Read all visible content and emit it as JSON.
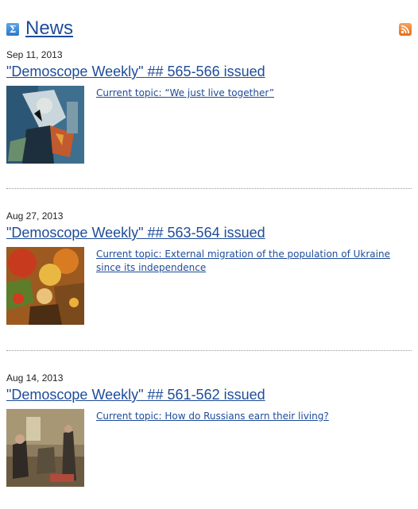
{
  "header": {
    "title": "News",
    "sigma_icon": "sigma-icon",
    "rss_icon": "rss-icon"
  },
  "items": [
    {
      "date": "Sep 11, 2013",
      "headline": "\"Demoscope Weekly\" ## 565-566 issued",
      "topic": "Current topic: “We just live together”",
      "thumbnail": "painting-thumbnail"
    },
    {
      "date": "Aug 27, 2013",
      "headline": "\"Demoscope Weekly\" ## 563-564 issued",
      "topic": "Current topic: External migration of the population of Ukraine since its independence",
      "thumbnail": "painting-thumbnail"
    },
    {
      "date": "Aug 14, 2013",
      "headline": "\"Demoscope Weekly\" ## 561-562 issued",
      "topic": "Current topic: How do Russians earn their living?",
      "thumbnail": "painting-thumbnail"
    }
  ]
}
